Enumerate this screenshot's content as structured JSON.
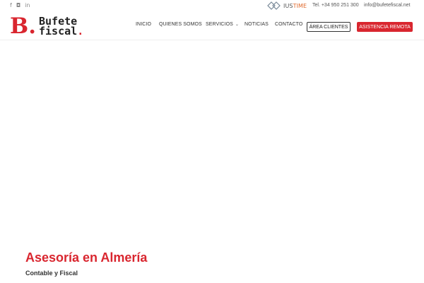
{
  "topbar": {
    "social": [
      {
        "icon": "facebook-icon",
        "glyph": "f"
      },
      {
        "icon": "instagram-icon",
        "glyph": "◘"
      },
      {
        "icon": "linkedin-icon",
        "glyph": "in"
      }
    ],
    "partner": {
      "name_main": "IUS",
      "name_accent": "TIME"
    },
    "phone": "Tel. +34 950 251 300",
    "email": "info@bufetefiscal.net"
  },
  "logo": {
    "letter": "B",
    "dot": ".",
    "word1": "Bufete",
    "word2": "fiscal",
    "word2_dot": "."
  },
  "nav": {
    "items": [
      "INICIO",
      "QUIENES SOMOS",
      "SERVICIOS",
      "NOTICIAS",
      "CONTACTO"
    ],
    "servicios_chevron": "⌄"
  },
  "buttons": {
    "area_clientes": "ÁREA CLIENTES",
    "asistencia_remota": "ASISTENCIA REMOTA"
  },
  "hero": {
    "title": "Asesoría en Almería",
    "subtitle": "Contable y Fiscal"
  },
  "colors": {
    "brand_red": "#d9262f",
    "partner_orange": "#e06a2c",
    "text_dark": "#333333"
  }
}
